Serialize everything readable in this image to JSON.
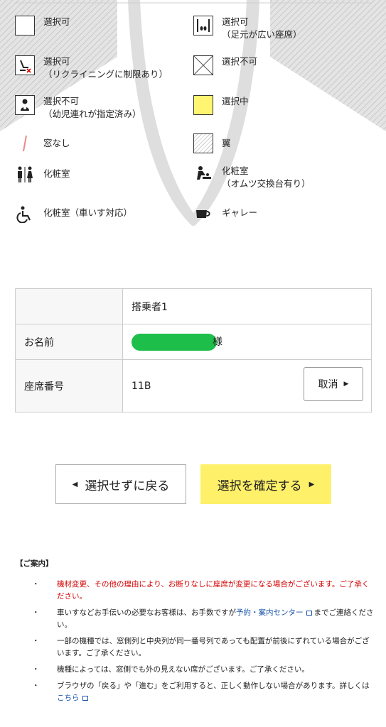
{
  "legend": {
    "items": [
      {
        "name": "available",
        "label": "選択可",
        "sub": ""
      },
      {
        "name": "available-legroom",
        "label": "選択可",
        "sub": "（足元が広い座席）"
      },
      {
        "name": "available-recline-limited",
        "label": "選択可",
        "sub": "（リクライニングに制限あり）"
      },
      {
        "name": "unavailable",
        "label": "選択不可",
        "sub": ""
      },
      {
        "name": "unavailable-infant",
        "label": "選択不可",
        "sub": "（幼児連れが指定済み）"
      },
      {
        "name": "selected",
        "label": "選択中",
        "sub": ""
      },
      {
        "name": "no-window",
        "label": "窓なし",
        "sub": ""
      },
      {
        "name": "wing",
        "label": "翼",
        "sub": ""
      },
      {
        "name": "lavatory",
        "label": "化粧室",
        "sub": ""
      },
      {
        "name": "lavatory-diaper",
        "label": "化粧室",
        "sub": "（オムツ交換台有り）"
      },
      {
        "name": "lavatory-wheelchair",
        "label": "化粧室（車いす対応）",
        "sub": ""
      },
      {
        "name": "galley",
        "label": "ギャレー",
        "sub": ""
      }
    ]
  },
  "passenger": {
    "header": "搭乗者1",
    "name_label": "お名前",
    "name_suffix": "様",
    "seat_label": "座席番号",
    "seat_value": "11B",
    "cancel_label": "取消"
  },
  "buttons": {
    "back": "選択せずに戻る",
    "confirm": "選択を確定する"
  },
  "notes": {
    "heading": "【ご案内】",
    "items": [
      {
        "text": "機材変更、その他の理由により、お断りなしに座席が変更になる場合がございます。ご了承ください。"
      },
      {
        "pre": "車いすなどお手伝いの必要なお客様は、お手数ですが",
        "link": "予約・案内センター",
        "post": "までご連絡ください。"
      },
      {
        "text": "一部の機種では、窓側列と中央列が同一番号列であっても配置が前後にずれている場合がございます。ご了承ください。"
      },
      {
        "text": "機種によっては、窓側でも外の見えない席がございます。ご了承ください。"
      },
      {
        "pre": "ブラウザの「戻る」や「進む」をご利用すると、正しく動作しない場合があります。詳しくは",
        "link": "こちら"
      }
    ]
  },
  "colors": {
    "selected": "#fff570",
    "confirm_button": "#fff06a",
    "warning_text": "#d40000",
    "link": "#1a54a8",
    "mask": "#1dbf4a"
  }
}
